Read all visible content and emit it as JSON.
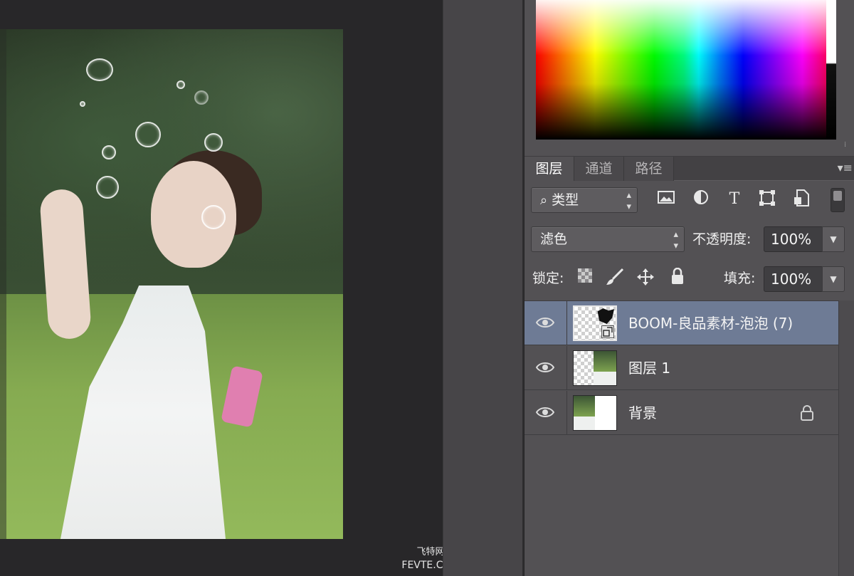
{
  "canvas": {
    "watermark_line1": "飞特网",
    "watermark_line2": "FEVTE.COM"
  },
  "layers_panel": {
    "tabs": [
      {
        "label": "图层",
        "active": true
      },
      {
        "label": "通道",
        "active": false
      },
      {
        "label": "路径",
        "active": false
      }
    ],
    "filter_kind": {
      "value": "类型",
      "icon": "search-icon"
    },
    "filter_icons": [
      "image-filter-icon",
      "adjustment-filter-icon",
      "type-filter-icon",
      "shape-filter-icon",
      "smart-object-filter-icon"
    ],
    "blend_mode": "滤色",
    "opacity_label": "不透明度:",
    "opacity_value": "100%",
    "lock_label": "锁定:",
    "lock_icons": [
      "lock-transparent-icon",
      "lock-image-icon",
      "lock-position-icon",
      "lock-all-icon"
    ],
    "fill_label": "填充:",
    "fill_value": "100%",
    "layers": [
      {
        "name": "BOOM-良品素材-泡泡 (7)",
        "selected": true,
        "visible": true,
        "locked": false
      },
      {
        "name": "图层 1",
        "selected": false,
        "visible": true,
        "locked": false
      },
      {
        "name": "背景",
        "selected": false,
        "visible": true,
        "locked": true
      }
    ],
    "selection_color": "#6e7b95"
  }
}
